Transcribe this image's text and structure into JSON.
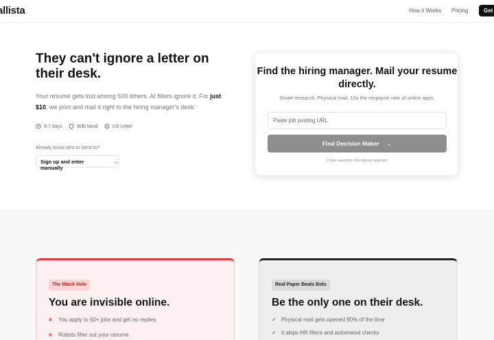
{
  "header": {
    "logo": "allista",
    "nav": {
      "how_it_works": "How it Works",
      "pricing": "Pricing",
      "cta": "Get"
    }
  },
  "hero": {
    "title": "They can't ignore a letter on their desk.",
    "subtitle_pre": "Your resume gets lost among 500 others. AI filters ignore it. For ",
    "subtitle_bold": "just $10",
    "subtitle_post": ", we print and mail it right to the hiring manager's desk.",
    "meta": [
      {
        "icon": "clock-icon",
        "label": "5-7 days"
      },
      {
        "icon": "shield-icon",
        "label": "90lb bond"
      },
      {
        "icon": "check-circle-icon",
        "label": "US Letter"
      }
    ],
    "already_text": "Already know who to send to?",
    "manual_button": "Sign up and enter manually"
  },
  "card": {
    "title": "Find the hiring manager. Mail your resume directly.",
    "subtitle": "Smart research. Physical mail. 10x the response rate of online apps.",
    "input_placeholder": "Paste job posting URL",
    "button": "Find Decision Maker",
    "note": "2 free searches. No signup required."
  },
  "comparison": {
    "bad": {
      "pill": "The Black Hole",
      "title": "You are invisible online.",
      "items": [
        "You apply to 50+ jobs and get no replies",
        "Robots filter out your resume"
      ]
    },
    "good": {
      "pill": "Real Paper Beats Bots",
      "title": "Be the only one on their desk.",
      "items": [
        "Physical mail gets opened 90% of the time",
        "It skips HR filters and automated checks"
      ]
    }
  },
  "colors": {
    "accent_dark": "#111111",
    "button_gray": "#8e8e8e",
    "bad_red": "#e43a3a",
    "bad_bg": "#fdf0f0"
  }
}
